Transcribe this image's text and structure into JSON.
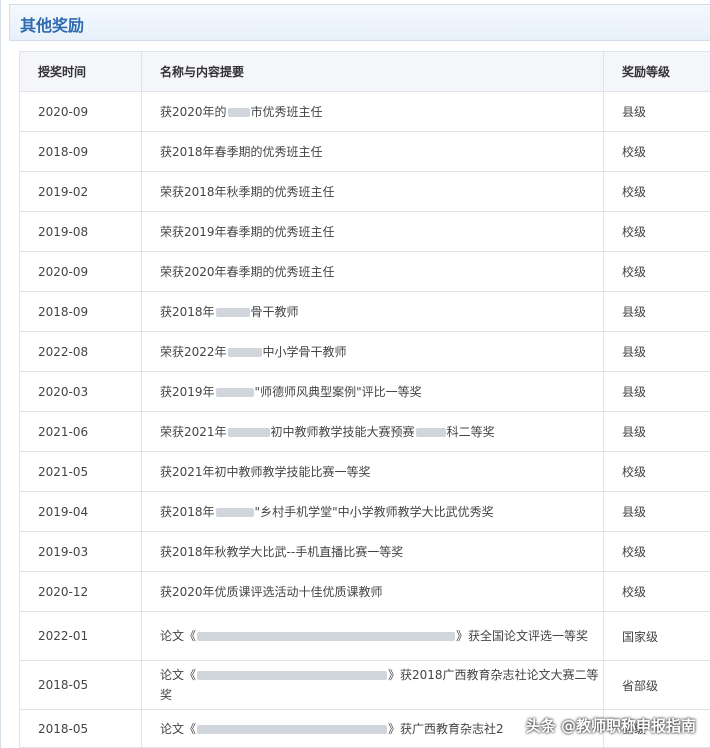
{
  "section": {
    "title": "其他奖励"
  },
  "table": {
    "headers": {
      "date": "授奖时间",
      "name": "名称与内容提要",
      "level": "奖励等级"
    },
    "rows": [
      {
        "date": "2020-09",
        "pre": "获2020年的",
        "redact": 22,
        "post": "市优秀班主任",
        "level": "县级"
      },
      {
        "date": "2018-09",
        "pre": "获2018年春季期的优秀班主任",
        "redact": 0,
        "post": "",
        "level": "校级"
      },
      {
        "date": "2019-02",
        "pre": "荣获2018年秋季期的优秀班主任",
        "redact": 0,
        "post": "",
        "level": "校级"
      },
      {
        "date": "2019-08",
        "pre": "荣获2019年春季期的优秀班主任",
        "redact": 0,
        "post": "",
        "level": "校级"
      },
      {
        "date": "2020-09",
        "pre": "荣获2020年春季期的优秀班主任",
        "redact": 0,
        "post": "",
        "level": "校级"
      },
      {
        "date": "2018-09",
        "pre": "获2018年",
        "redact": 34,
        "post": "骨干教师",
        "level": "县级"
      },
      {
        "date": "2022-08",
        "pre": "荣获2022年",
        "redact": 34,
        "post": "中小学骨干教师",
        "level": "县级"
      },
      {
        "date": "2020-03",
        "pre": "获2019年",
        "redact": 38,
        "post": "\"师德师风典型案例\"评比一等奖",
        "level": "县级"
      },
      {
        "date": "2021-06",
        "pre": "荣获2021年",
        "redact": 42,
        "post": "初中教师教学技能大赛预赛",
        "redact2": 30,
        "post2": "科二等奖",
        "level": "县级"
      },
      {
        "date": "2021-05",
        "pre": "获2021年初中教师教学技能比赛一等奖",
        "redact": 0,
        "post": "",
        "level": "校级"
      },
      {
        "date": "2019-04",
        "pre": "获2018年",
        "redact": 38,
        "post": "\"乡村手机学堂\"中小学教师教学大比武优秀奖",
        "level": "县级"
      },
      {
        "date": "2019-03",
        "pre": "获2018年秋教学大比武--手机直播比赛一等奖",
        "redact": 0,
        "post": "",
        "level": "校级"
      },
      {
        "date": "2020-12",
        "pre": "获2020年优质课评选活动十佳优质课教师",
        "redact": 0,
        "post": "",
        "level": "校级"
      },
      {
        "date": "2022-01",
        "pre": "论文《",
        "redact": 258,
        "post": "》获全国论文评选一等奖",
        "level": "国家级",
        "tall": true
      },
      {
        "date": "2018-05",
        "pre": "论文《",
        "redact": 190,
        "post": "》获2018广西教育杂志社论文大赛二等奖",
        "level": "省部级",
        "tall": true
      },
      {
        "date": "2018-05",
        "pre": "论文《",
        "redact": 190,
        "post": "》获广西教育杂志社2",
        "level": "县级",
        "last": true
      }
    ]
  },
  "watermark": {
    "text": "头条 @教师职称申报指南"
  }
}
